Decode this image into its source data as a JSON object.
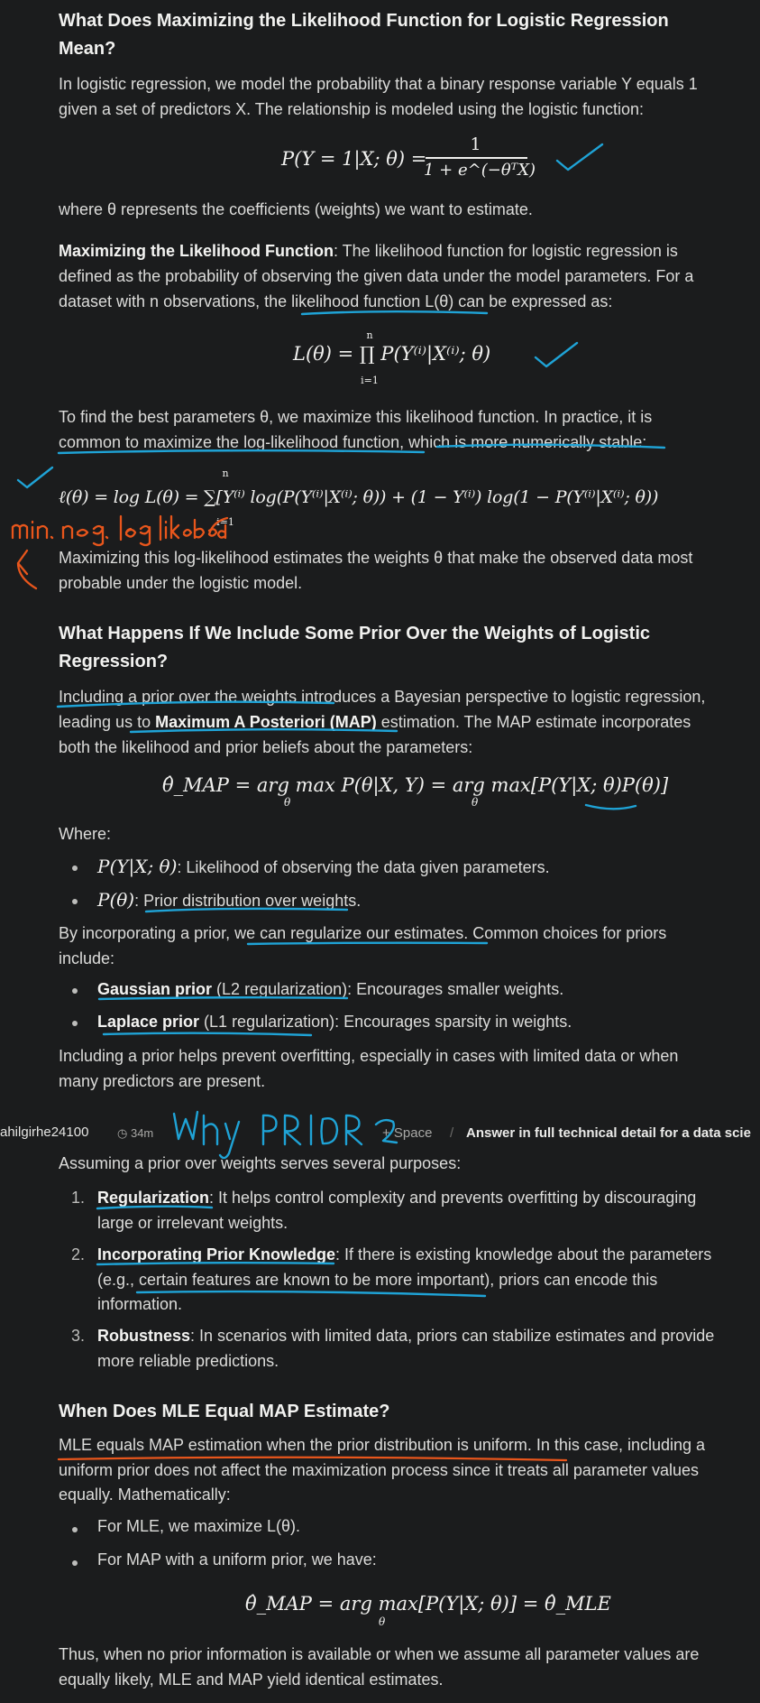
{
  "sec1": {
    "heading_l1": "What Does Maximizing the Likelihood Function for Logistic Regression",
    "heading_l2": "Mean?",
    "intro_l1": "In logistic regression, we model the probability that a binary response variable Y equals 1",
    "intro_l2": "given a set of predictors X. The relationship is modeled using the logistic function:",
    "eq1_left": "P(Y = 1|X; θ) = ",
    "eq1_num": "1",
    "eq1_den": "1 + e^(−θᵀX)",
    "where": "where θ represents the coefficients (weights) we want to estimate.",
    "mlf_bold": "Maximizing the Likelihood Function",
    "mlf_l1": ": The likelihood function for logistic regression is",
    "mlf_l2": "defined as the probability of observing the given data under the model parameters. For a",
    "mlf_l3": "dataset with n observations, the likelihood function L(θ) can be expressed as:",
    "eq2": "L(θ) = ∏ P(Y⁽ⁱ⁾|X⁽ⁱ⁾; θ)",
    "eq2_top": "n",
    "eq2_bot": "i=1",
    "loglik_l1": "To find the best parameters θ, we maximize this likelihood function. In practice, it is",
    "loglik_l2": "common to maximize the log-likelihood function, which is more numerically stable:",
    "eq3": "ℓ(θ) = log L(θ) = ∑[Y⁽ⁱ⁾ log(P(Y⁽ⁱ⁾|X⁽ⁱ⁾; θ)) + (1 − Y⁽ⁱ⁾) log(1 − P(Y⁽ⁱ⁾|X⁽ⁱ⁾; θ))",
    "eq3_top": "n",
    "eq3_bot": "i=1",
    "concl_l1": "Maximizing this log-likelihood estimates the weights θ that make the observed data most",
    "concl_l2": "probable under the logistic model."
  },
  "sec2": {
    "heading_l1": "What Happens If We Include Some Prior Over the Weights of Logistic",
    "heading_l2": "Regression?",
    "p1_l1": "Including a prior over the weights introduces a Bayesian perspective to logistic regression,",
    "p1_l2_a": "leading us to ",
    "p1_l2_bold": "Maximum A Posteriori (MAP)",
    "p1_l2_b": " estimation. The MAP estimate incorporates",
    "p1_l3": "both the likelihood and prior beliefs about the parameters:",
    "eq4": "θ̂_MAP = arg max P(θ|X, Y) = arg max[P(Y|X; θ)P(θ)]",
    "eq4_sub1": "θ",
    "eq4_sub2": "θ",
    "where": "Where:",
    "b1_math": "P(Y|X; θ)",
    "b1_text": ": Likelihood of observing the data given parameters.",
    "b2_math": "P(θ)",
    "b2_text": ": Prior distribution over weights.",
    "reg_l1": "By incorporating a prior, we can regularize our estimates. Common choices for priors",
    "reg_l2": "include:",
    "g_bold": "Gaussian prior",
    "g_text": " (L2 regularization): Encourages smaller weights.",
    "l_bold": "Laplace prior",
    "l_text": " (L1 regularization): Encourages sparsity in weights.",
    "of_l1": "Including a prior helps prevent overfitting, especially in cases with limited data or when",
    "of_l2": "many predictors are present."
  },
  "topbar": {
    "user": "ahilgirhe24100",
    "clock_icon": "clock-icon",
    "time": "34m",
    "space": "+ Space",
    "sep": "/",
    "title": "Answer in full technical detail for a data scie"
  },
  "sec3": {
    "partial": "Assuming a prior over weights serves several purposes:",
    "i1_bold": "Regularization",
    "i1_l1": ": It helps control complexity and prevents overfitting by discouraging",
    "i1_l2": "large or irrelevant weights.",
    "i2_bold": "Incorporating Prior Knowledge",
    "i2_l1": ": If there is existing knowledge about the parameters",
    "i2_l2": "(e.g., certain features are known to be more important), priors can encode this",
    "i2_l3": "information.",
    "i3_bold": "Robustness",
    "i3_l1": ": In scenarios with limited data, priors can stabilize estimates and provide",
    "i3_l2": "more reliable predictions."
  },
  "sec4": {
    "heading": "When Does MLE Equal MAP Estimate?",
    "p_l1": "MLE equals MAP estimation when the prior distribution is uniform. In this case, including a",
    "p_l2": "uniform prior does not affect the maximization process since it treats all parameter values",
    "p_l3": "equally. Mathematically:",
    "b1": "For MLE, we maximize L(θ).",
    "b2": "For MAP with a uniform prior, we have:",
    "eq5": "θ̂_MAP = arg max[P(Y|X; θ)] = θ̂_MLE",
    "eq5_sub": "θ",
    "final_l1": "Thus, when no prior information is available or when we assume all parameter values are",
    "final_l2": "equally likely, MLE and MAP yield identical estimates."
  },
  "annotations": {
    "min_neg": "min. neg. log likelihood",
    "why_prior": "Why PRIOR ?",
    "ink_blue": "#1fa3d6",
    "ink_orange": "#e8561c"
  }
}
